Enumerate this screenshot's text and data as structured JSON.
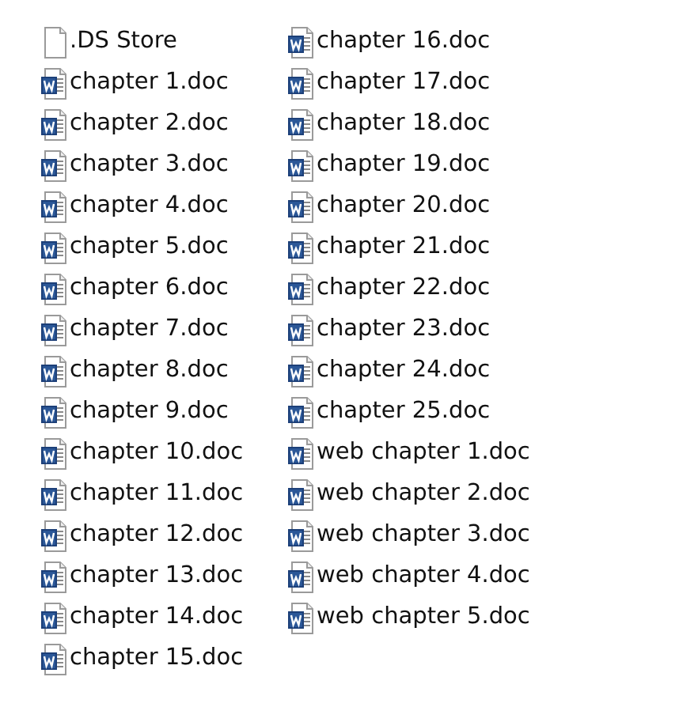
{
  "files": [
    {
      "name": ".DS Store",
      "kind": "blank"
    },
    {
      "name": "chapter 1.doc",
      "kind": "word"
    },
    {
      "name": "chapter 2.doc",
      "kind": "word"
    },
    {
      "name": "chapter 3.doc",
      "kind": "word"
    },
    {
      "name": "chapter 4.doc",
      "kind": "word"
    },
    {
      "name": "chapter 5.doc",
      "kind": "word"
    },
    {
      "name": "chapter 6.doc",
      "kind": "word"
    },
    {
      "name": "chapter 7.doc",
      "kind": "word"
    },
    {
      "name": "chapter 8.doc",
      "kind": "word"
    },
    {
      "name": "chapter 9.doc",
      "kind": "word"
    },
    {
      "name": "chapter 10.doc",
      "kind": "word"
    },
    {
      "name": "chapter 11.doc",
      "kind": "word"
    },
    {
      "name": "chapter 12.doc",
      "kind": "word"
    },
    {
      "name": "chapter 13.doc",
      "kind": "word"
    },
    {
      "name": "chapter 14.doc",
      "kind": "word"
    },
    {
      "name": "chapter 15.doc",
      "kind": "word"
    },
    {
      "name": "chapter 16.doc",
      "kind": "word"
    },
    {
      "name": "chapter 17.doc",
      "kind": "word"
    },
    {
      "name": "chapter 18.doc",
      "kind": "word"
    },
    {
      "name": "chapter 19.doc",
      "kind": "word"
    },
    {
      "name": "chapter 20.doc",
      "kind": "word"
    },
    {
      "name": "chapter 21.doc",
      "kind": "word"
    },
    {
      "name": "chapter 22.doc",
      "kind": "word"
    },
    {
      "name": "chapter 23.doc",
      "kind": "word"
    },
    {
      "name": "chapter 24.doc",
      "kind": "word"
    },
    {
      "name": "chapter 25.doc",
      "kind": "word"
    },
    {
      "name": "web chapter 1.doc",
      "kind": "word"
    },
    {
      "name": "web chapter 2.doc",
      "kind": "word"
    },
    {
      "name": "web chapter 3.doc",
      "kind": "word"
    },
    {
      "name": "web chapter 4.doc",
      "kind": "word"
    },
    {
      "name": "web chapter 5.doc",
      "kind": "word"
    }
  ]
}
